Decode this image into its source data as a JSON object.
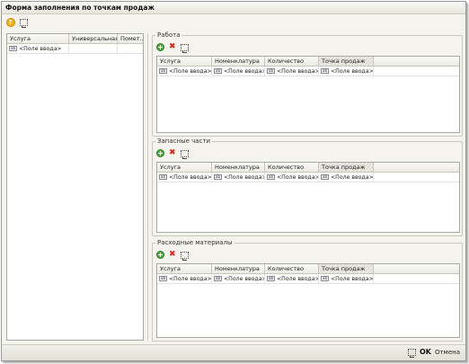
{
  "window": {
    "title": "Форма заполнения по точкам продаж"
  },
  "toolbar": {
    "help_icon": "help-icon",
    "help_glyph": "?",
    "settings_icon": "form-settings-icon"
  },
  "left_table": {
    "columns": [
      "Услуга",
      "Универсальная",
      "Помет..."
    ],
    "rows": [
      {
        "service": "<Поле ввода>"
      }
    ]
  },
  "groups": {
    "work": {
      "title": "Работа",
      "columns": [
        "Услуга",
        "Номенклатура",
        "Количество",
        "Точка продаж"
      ],
      "row": [
        "<Поле ввода>",
        "<Поле ввода>",
        "<Поле ввода>",
        "<Поле ввода>"
      ]
    },
    "parts": {
      "title": "Запасные части",
      "columns": [
        "Услуга",
        "Номенклатура",
        "Количество",
        "Точка продаж"
      ],
      "row": [
        "<Поле ввода>",
        "<Поле ввода>",
        "<Поле ввода>",
        "<Поле ввода>"
      ]
    },
    "materials": {
      "title": "Расходные материалы",
      "columns": [
        "Услуга",
        "Номенклатура",
        "Количество",
        "Точка продаж"
      ],
      "row": [
        "<Поле ввода>",
        "<Поле ввода>",
        "<Поле ввода>",
        "<Поле ввода>"
      ]
    }
  },
  "icons": {
    "add": "+",
    "delete": "✖",
    "field_type": "ab"
  },
  "footer": {
    "ok_label": "OK",
    "cancel_label": "Отмена"
  }
}
